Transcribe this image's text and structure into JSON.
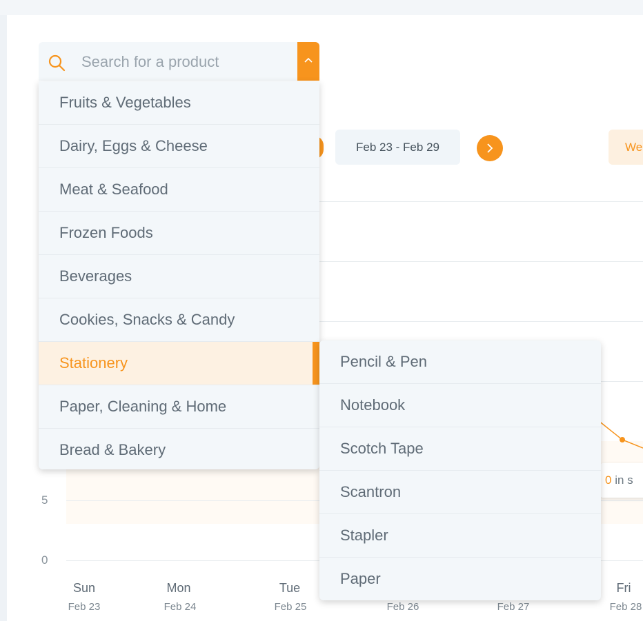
{
  "search": {
    "placeholder": "Search for a product",
    "icon": "search-icon",
    "toggle_icon": "chevron-up-icon"
  },
  "categories": [
    {
      "label": "Fruits & Vegetables"
    },
    {
      "label": "Dairy, Eggs & Cheese"
    },
    {
      "label": "Meat & Seafood"
    },
    {
      "label": "Frozen Foods"
    },
    {
      "label": "Beverages"
    },
    {
      "label": "Cookies, Snacks & Candy"
    },
    {
      "label": "Stationery",
      "active": true
    },
    {
      "label": "Paper, Cleaning & Home"
    },
    {
      "label": "Bread & Bakery"
    }
  ],
  "subcategories": [
    {
      "label": "Pencil & Pen"
    },
    {
      "label": "Notebook"
    },
    {
      "label": "Scotch Tape"
    },
    {
      "label": "Scantron"
    },
    {
      "label": "Stapler"
    },
    {
      "label": "Paper"
    }
  ],
  "week_nav": {
    "range": "Feb 23 - Feb 29",
    "view_toggle_label": "We"
  },
  "chart": {
    "y_ticks": [
      "5",
      "0"
    ],
    "days": [
      {
        "day": "Sun",
        "date": "Feb 23"
      },
      {
        "day": "Mon",
        "date": "Feb 24"
      },
      {
        "day": "Tue",
        "date": "Feb 25"
      },
      {
        "day": "",
        "date": "Feb 26"
      },
      {
        "day": "",
        "date": "Feb 27"
      },
      {
        "day": "Fri",
        "date": "Feb 28"
      }
    ],
    "tooltip_value": "0",
    "tooltip_text": " in s"
  },
  "colors": {
    "accent": "#f7941d",
    "active_bg": "#fdf1e2",
    "menu_bg": "#f3f7fa"
  }
}
